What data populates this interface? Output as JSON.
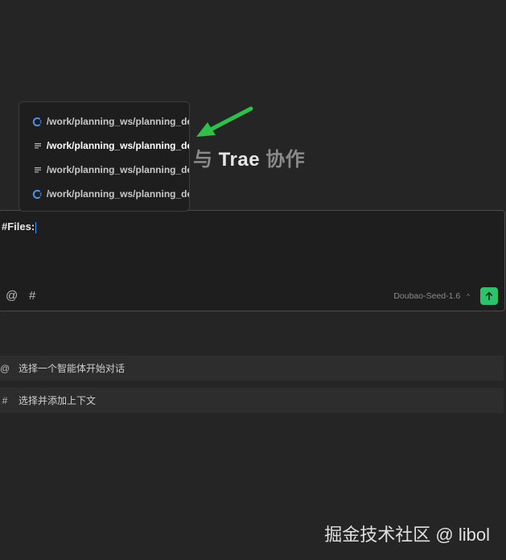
{
  "headline": {
    "prefix": "与",
    "brand": "Trae",
    "suffix": "协作"
  },
  "file_dropdown": {
    "items": [
      {
        "path": "/work/planning_ws/planning_de",
        "icon": "cpp-file-icon",
        "active": false
      },
      {
        "path": "/work/planning_ws/planning_de",
        "icon": "text-file-icon",
        "active": true
      },
      {
        "path": "/work/planning_ws/planning_de",
        "icon": "text-file-icon",
        "active": false
      },
      {
        "path": "/work/planning_ws/planning_de",
        "icon": "cpp-file-icon",
        "active": false
      }
    ]
  },
  "composer": {
    "value": "#Files:",
    "mention_symbol": "@",
    "context_symbol": "#",
    "model": "Doubao-Seed-1.6",
    "model_chevron": "^",
    "send_icon": "arrow-up-icon"
  },
  "hints": [
    {
      "symbol": "@",
      "label": "选择一个智能体开始对话"
    },
    {
      "symbol": "#",
      "label": "选择并添加上下文"
    }
  ],
  "watermark": "掘金技术社区 @ libol",
  "colors": {
    "accent": "#2bc46a",
    "annotation_arrow": "#2fbf4a",
    "cpp_icon": "#4f8fe0"
  }
}
